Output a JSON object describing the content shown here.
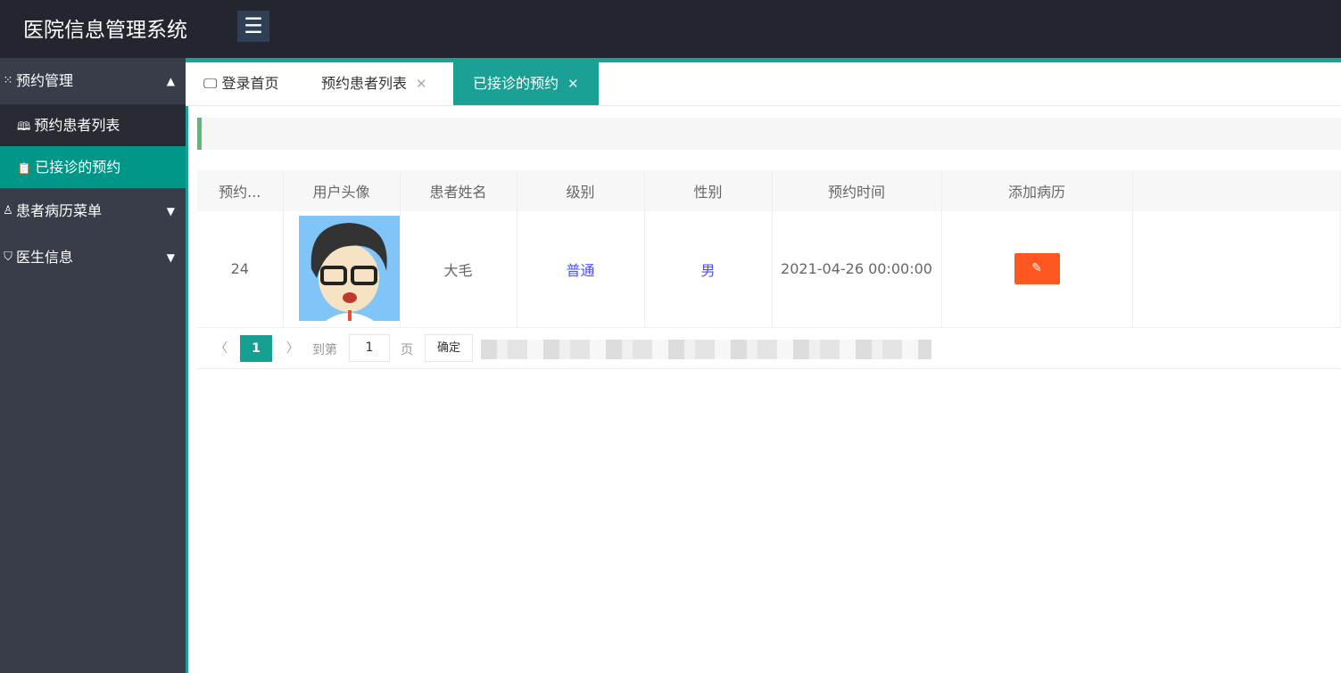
{
  "header": {
    "title": "医院信息管理系统",
    "menu_icon": "☰"
  },
  "sidebar": {
    "groups": [
      {
        "label": "预约管理",
        "icon": "grid-icon",
        "items": [
          {
            "label": "预约患者列表"
          },
          {
            "label": "已接诊的预约"
          }
        ]
      },
      {
        "label": "患者病历菜单",
        "icon": "user-icon"
      },
      {
        "label": "医生信息",
        "icon": "shield-icon"
      }
    ]
  },
  "tabs": [
    {
      "label": "登录首页"
    },
    {
      "label": "预约患者列表"
    },
    {
      "label": "已接诊的预约"
    }
  ],
  "table": {
    "headers": [
      "预约...",
      "用户头像",
      "患者姓名",
      "级别",
      "性别",
      "预约时间",
      "添加病历"
    ],
    "rows": [
      {
        "id": "24",
        "name": "大毛",
        "level": "普通",
        "gender": "男",
        "time": "2021-04-26 00:00:00"
      }
    ]
  },
  "pager": {
    "prev": "〈",
    "current": "1",
    "next": "〉",
    "goto": "到第",
    "page_value": "1",
    "page_unit": "页",
    "confirm": "确定"
  },
  "colors": {
    "accent": "#1aa094",
    "edit": "#ff5722",
    "header": "#23262e"
  }
}
